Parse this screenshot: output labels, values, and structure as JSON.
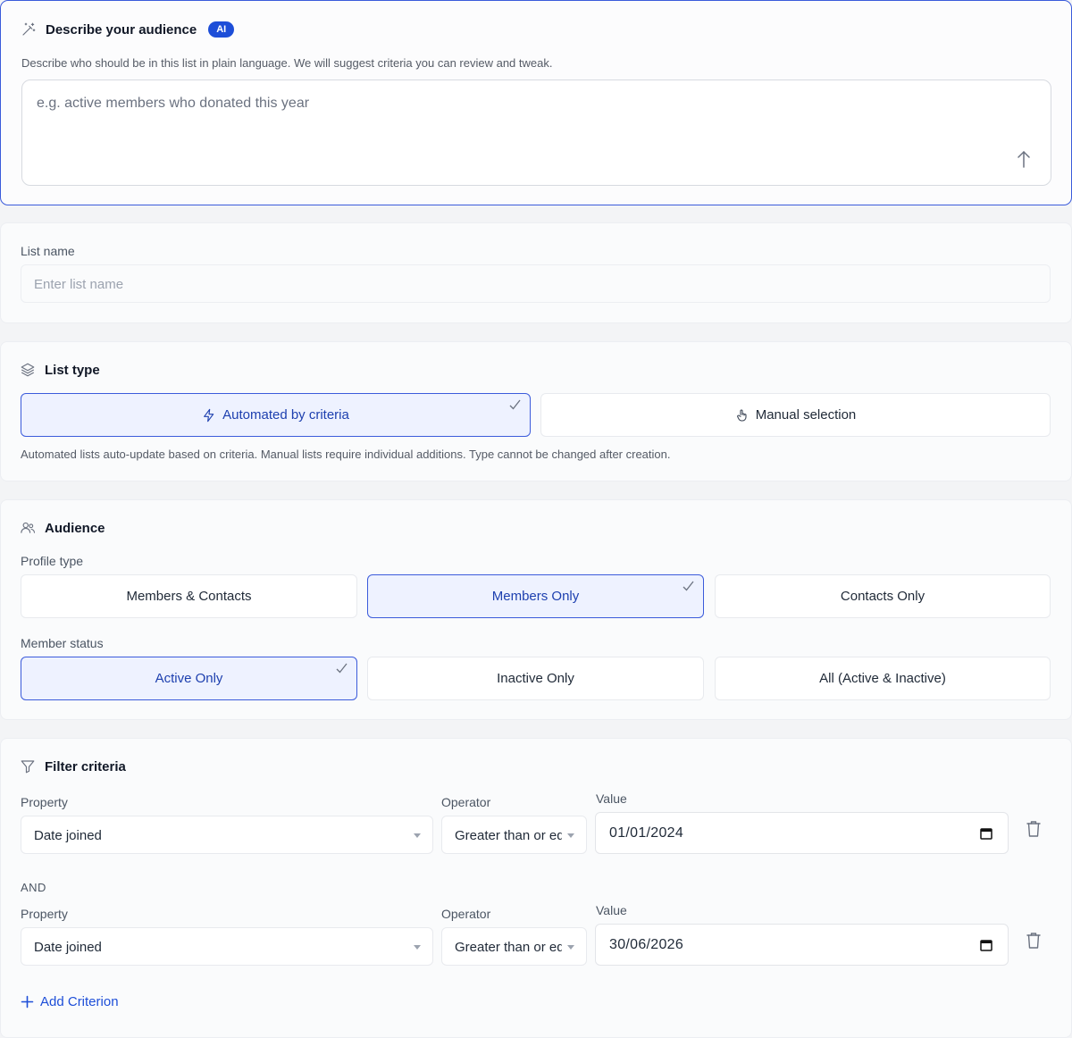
{
  "ai_panel": {
    "title": "Describe your audience",
    "badge": "AI",
    "description": "Describe who should be in this list in plain language. We will suggest criteria you can review and tweak.",
    "placeholder": "e.g. active members who donated this year"
  },
  "list_name": {
    "label": "List name",
    "placeholder": "Enter list name"
  },
  "list_type": {
    "title": "List type",
    "options": [
      {
        "label": "Automated by criteria",
        "selected": true
      },
      {
        "label": "Manual selection",
        "selected": false
      }
    ],
    "help": "Automated lists auto-update based on criteria. Manual lists require individual additions. Type cannot be changed after creation."
  },
  "audience": {
    "title": "Audience",
    "profile_type_label": "Profile type",
    "profile_types": [
      {
        "label": "Members & Contacts",
        "selected": false
      },
      {
        "label": "Members Only",
        "selected": true
      },
      {
        "label": "Contacts Only",
        "selected": false
      }
    ],
    "member_status_label": "Member status",
    "member_statuses": [
      {
        "label": "Active Only",
        "selected": true
      },
      {
        "label": "Inactive Only",
        "selected": false
      },
      {
        "label": "All (Active & Inactive)",
        "selected": false
      }
    ]
  },
  "filter": {
    "title": "Filter criteria",
    "conjunction": "AND",
    "criteria": [
      {
        "property_label": "Property",
        "property": "Date joined",
        "operator_label": "Operator",
        "operator": "Greater than or equal",
        "value_label": "Value",
        "value": "01/01/2024"
      },
      {
        "property_label": "Property",
        "property": "Date joined",
        "operator_label": "Operator",
        "operator": "Greater than or equal",
        "value_label": "Value",
        "value": "30/06/2026"
      }
    ],
    "add_label": "Add Criterion"
  },
  "colors": {
    "accent": "#1d4ed8",
    "selected_bg": "#eef2ff",
    "selected_border": "#3b5bdb"
  }
}
